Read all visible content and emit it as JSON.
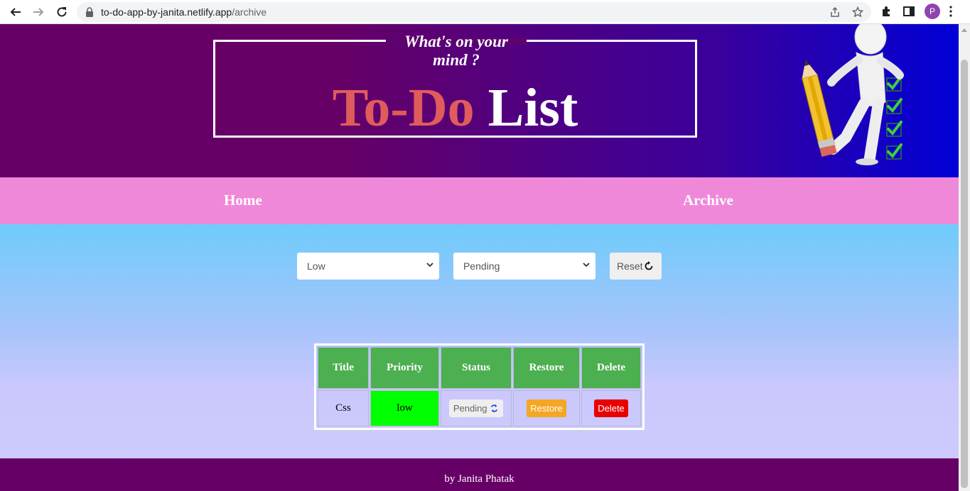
{
  "browser": {
    "url_host": "to-do-app-by-janita.netlify.app",
    "url_path": "/archive",
    "profile_initial": "P"
  },
  "header": {
    "tagline": "What's on your mind ?",
    "title_part1": "To-Do",
    "title_part2": "List"
  },
  "nav": {
    "home": "Home",
    "archive": "Archive"
  },
  "filters": {
    "priority_selected": "Low",
    "status_selected": "Pending",
    "reset_label": "Reset"
  },
  "table": {
    "headers": [
      "Title",
      "Priority",
      "Status",
      "Restore",
      "Delete"
    ],
    "rows": [
      {
        "title": "Css",
        "priority": "low",
        "status": "Pending",
        "restore": "Restore",
        "delete": "Delete"
      }
    ]
  },
  "colors": {
    "header_start": "#660066",
    "header_end": "#0000d6",
    "navbar": "#f088da",
    "table_header": "#4caf50",
    "priority_low": "#00ff00",
    "restore": "#f5a623",
    "delete": "#e80000",
    "footer": "#660066"
  },
  "footer": {
    "credit": "by Janita Phatak"
  }
}
